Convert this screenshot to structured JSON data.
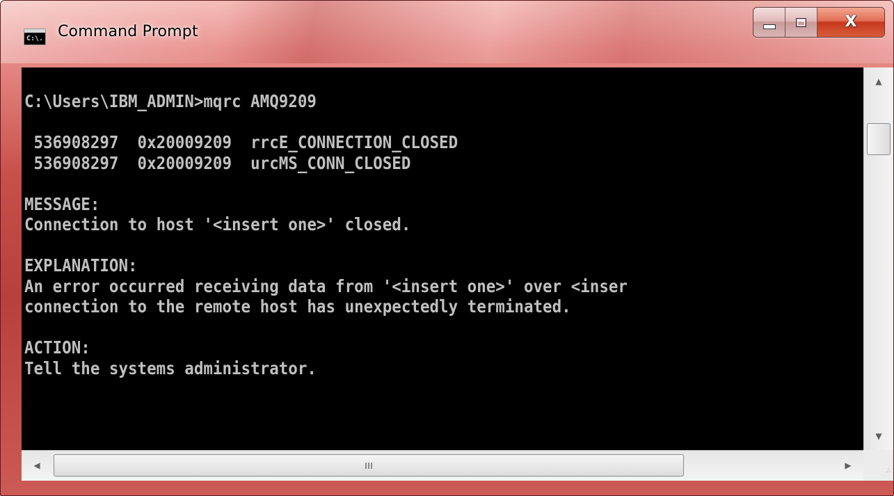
{
  "window": {
    "title": "Command Prompt",
    "icon": "cmd-icon",
    "icon_text": "C:\\.",
    "frame_color": "#c8504b",
    "close_color": "#c7381c"
  },
  "console": {
    "background": "#000000",
    "text_color": "#c0c0c0",
    "lines": [
      "C:\\Users\\IBM_ADMIN>mqrc AMQ9209",
      "",
      " 536908297  0x20009209  rrcE_CONNECTION_CLOSED",
      " 536908297  0x20009209  urcMS_CONN_CLOSED",
      "",
      "MESSAGE:",
      "Connection to host '<insert one>' closed.",
      "",
      "EXPLANATION:",
      "An error occurred receiving data from '<insert one>' over <inser",
      "connection to the remote host has unexpectedly terminated.",
      "",
      "ACTION:",
      "Tell the systems administrator."
    ]
  },
  "scrollbars": {
    "up_arrow": "▲",
    "down_arrow": "▼",
    "left_arrow": "◀",
    "right_arrow": "▶"
  }
}
